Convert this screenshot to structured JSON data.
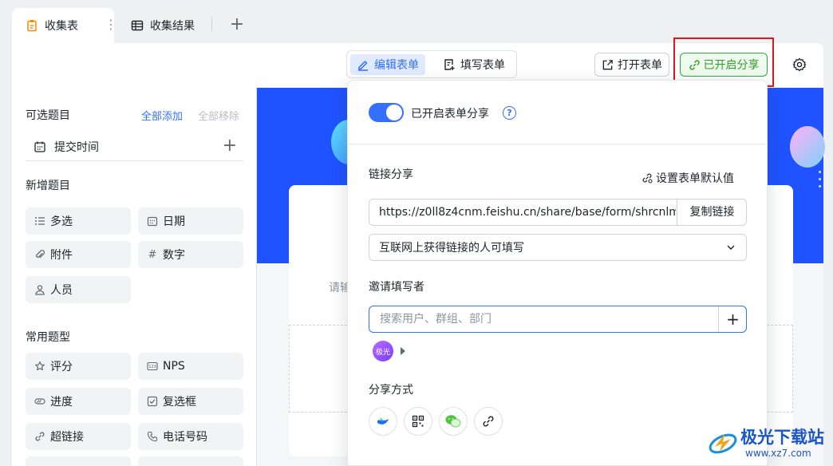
{
  "tabs": [
    {
      "label": "收集表",
      "icon": "form-doc-icon",
      "active": true
    },
    {
      "label": "收集结果",
      "icon": "table-grid-icon",
      "active": false
    }
  ],
  "tab_more": "⋮",
  "tab_add": "+",
  "toolbar": {
    "edit_form": "编辑表单",
    "fill_form": "填写表单",
    "open_form": "打开表单",
    "share_enabled": "已开启分享"
  },
  "left_panel": {
    "title": "可选题目",
    "add_all": "全部添加",
    "remove_all": "全部移除",
    "submit_time": "提交时间",
    "new_section": "新增题目",
    "new_items": [
      {
        "label": "多选",
        "icon": "multi-select-icon"
      },
      {
        "label": "日期",
        "icon": "calendar-icon"
      },
      {
        "label": "附件",
        "icon": "paperclip-icon"
      },
      {
        "label": "数字",
        "icon": "hash-icon"
      },
      {
        "label": "人员",
        "icon": "person-icon"
      }
    ],
    "common_section": "常用题型",
    "common_items": [
      {
        "label": "评分",
        "icon": "star-icon"
      },
      {
        "label": "NPS",
        "icon": "nps-icon"
      },
      {
        "label": "进度",
        "icon": "progress-icon"
      },
      {
        "label": "复选框",
        "icon": "checkbox-icon"
      },
      {
        "label": "超链接",
        "icon": "link-icon"
      },
      {
        "label": "电话号码",
        "icon": "phone-icon"
      }
    ]
  },
  "canvas": {
    "hint": "请输"
  },
  "share_popover": {
    "toggle_label": "已开启表单分享",
    "toggle_on": true,
    "help": "?",
    "link_share_label": "链接分享",
    "set_default": "设置表单默认值",
    "url": "https://z0ll8z4cnm.feishu.cn/share/base/form/shrcnlm",
    "copy_link": "复制链接",
    "permission": "互联网上获得链接的人可填写",
    "invite_label": "邀请填写者",
    "invite_placeholder": "搜索用户、群组、部门",
    "invite_add": "+",
    "avatar_text": "极光",
    "share_method_label": "分享方式",
    "share_methods": [
      "feishu-icon",
      "qrcode-icon",
      "wechat-icon",
      "link-icon"
    ]
  },
  "watermark": {
    "title": "极光下载站",
    "url": "www.xz7.com"
  },
  "colors": {
    "accent": "#3370ff",
    "share_green": "#2ea121",
    "banner": "#1f53ff",
    "highlight_red": "#e0161e"
  }
}
